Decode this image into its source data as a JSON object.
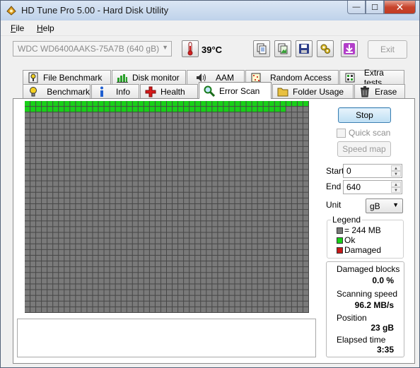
{
  "window": {
    "title": "HD Tune Pro 5.00 - Hard Disk Utility",
    "minimize_glyph": "—",
    "maximize_glyph": "☐",
    "close_glyph": "✕"
  },
  "menu": {
    "file": {
      "accel": "F",
      "rest": "ile"
    },
    "help": {
      "accel": "H",
      "rest": "elp"
    }
  },
  "toolbar": {
    "drive": "WDC WD6400AAKS-75A7B   (640 gB)",
    "temperature": "39°C",
    "exit_label": "Exit",
    "icons": [
      "thermometer-icon",
      "copy-info-icon",
      "copy-screenshot-icon",
      "save-icon",
      "options-icon",
      "download-icon"
    ]
  },
  "tabs_top": [
    {
      "label": "File Benchmark",
      "icon": "file-benchmark-icon"
    },
    {
      "label": "Disk monitor",
      "icon": "disk-monitor-icon"
    },
    {
      "label": "AAM",
      "icon": "speaker-icon"
    },
    {
      "label": "Random Access",
      "icon": "random-access-icon"
    },
    {
      "label": "Extra tests",
      "icon": "extra-tests-icon"
    }
  ],
  "tabs_bottom": [
    {
      "label": "Benchmark",
      "icon": "benchmark-icon"
    },
    {
      "label": "Info",
      "icon": "info-icon"
    },
    {
      "label": "Health",
      "icon": "health-cross-icon"
    },
    {
      "label": "Error Scan",
      "icon": "magnifier-icon",
      "active": true
    },
    {
      "label": "Folder Usage",
      "icon": "folder-icon"
    },
    {
      "label": "Erase",
      "icon": "trash-icon"
    }
  ],
  "scan": {
    "grid_columns": 50,
    "grid_rows": 37,
    "scanned_blocks": 96,
    "total_blocks": 1850,
    "colors": {
      "ok": "#18d018",
      "pending": "#7a7a7a",
      "damaged": "#c81818",
      "grid_line": "#474747"
    }
  },
  "controls": {
    "stop_label": "Stop",
    "quick_scan_label": "Quick scan",
    "speed_map_label": "Speed map",
    "start_label": "Start",
    "start_value": "0",
    "end_label": "End",
    "end_value": "640",
    "unit_label": "Unit",
    "unit_value": "gB"
  },
  "legend": {
    "title": "Legend",
    "items": [
      {
        "label": "= 244 MB",
        "color": "#7a7a7a"
      },
      {
        "label": "Ok",
        "color": "#18d018"
      },
      {
        "label": "Damaged",
        "color": "#c81818"
      }
    ]
  },
  "stats": {
    "damaged_blocks_label": "Damaged blocks",
    "damaged_blocks_value": "0.0 %",
    "scanning_speed_label": "Scanning speed",
    "scanning_speed_value": "96.2 MB/s",
    "position_label": "Position",
    "position_value": "23 gB",
    "elapsed_label": "Elapsed time",
    "elapsed_value": "3:35"
  }
}
